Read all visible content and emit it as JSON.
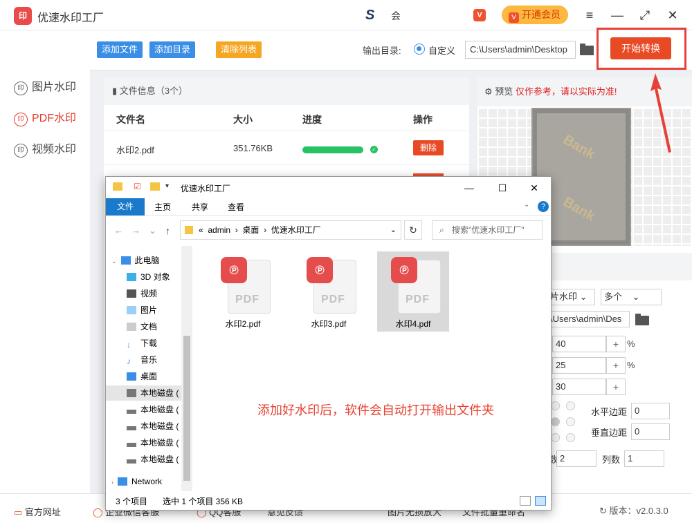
{
  "app": {
    "logo": "印",
    "title": "优速水印工厂",
    "brand_mark": "S",
    "brand_text": "会",
    "vip_icon": "V",
    "vip_button": "开通会员",
    "vip_k": "V"
  },
  "window_controls": {
    "menu": "≡",
    "minimize": "—",
    "maximize": "⤢",
    "close": "✕"
  },
  "sidebar": {
    "items": [
      {
        "icon": "印",
        "label": "图片水印"
      },
      {
        "icon": "印",
        "label": "PDF水印"
      },
      {
        "icon": "印",
        "label": "视频水印"
      }
    ]
  },
  "toolbar": {
    "add_file": "添加文件",
    "add_dir": "添加目录",
    "clear_list": "清除列表",
    "output_label": "输出目录:",
    "radio_custom": "自定义",
    "output_path": "C:\\Users\\admin\\Desktop",
    "start": "开始转换"
  },
  "file_panel": {
    "header": "文件信息（3个）",
    "columns": [
      "文件名",
      "大小",
      "进度",
      "操作"
    ],
    "rows": [
      {
        "name": "水印2.pdf",
        "size": "351.76KB",
        "progress": 1.0,
        "action": "删除"
      }
    ]
  },
  "preview": {
    "title": "预览",
    "warning": "仅作参考，请以实际为准!",
    "watermark_text": "Bank"
  },
  "settings": {
    "type": "片水印",
    "count": "多个",
    "path": "\\Users\\admin\\Des",
    "v1": "40",
    "v2": "25",
    "v3": "30",
    "plus": "+",
    "pct": "%",
    "h_margin_label": "水平边距",
    "h_margin": "0",
    "v_margin_label": "垂直边距",
    "v_margin": "0",
    "rows_label": "数",
    "rows": "2",
    "cols_label": "列数",
    "cols": "1"
  },
  "statusbar": {
    "items": [
      "官方网址",
      "企业微信客服",
      "QQ客服",
      "意见反馈",
      "图片无损放大",
      "文件批量重命名"
    ],
    "version": "版本：v2.0.3.0"
  },
  "explorer": {
    "title": "优速水印工厂",
    "ribbon": [
      "文件",
      "主页",
      "共享",
      "查看"
    ],
    "address": [
      "«",
      "admin",
      "›",
      "桌面",
      "›",
      "优速水印工厂"
    ],
    "search_placeholder": "搜索\"优速水印工厂\"",
    "tree": [
      {
        "label": "此电脑"
      },
      {
        "label": "3D 对象"
      },
      {
        "label": "视频"
      },
      {
        "label": "图片"
      },
      {
        "label": "文档"
      },
      {
        "label": "下载"
      },
      {
        "label": "音乐"
      },
      {
        "label": "桌面"
      },
      {
        "label": "本地磁盘 ("
      },
      {
        "label": "本地磁盘 ("
      },
      {
        "label": "本地磁盘 ("
      },
      {
        "label": "本地磁盘 ("
      },
      {
        "label": "本地磁盘 ("
      },
      {
        "label": "Network"
      }
    ],
    "files": [
      {
        "name": "水印2.pdf",
        "pdf": "PDF"
      },
      {
        "name": "水印3.pdf",
        "pdf": "PDF"
      },
      {
        "name": "水印4.pdf",
        "pdf": "PDF"
      }
    ],
    "note": "添加好水印后，软件会自动打开输出文件夹",
    "status_count": "3 个项目",
    "status_sel": "选中 1 个项目  356 KB"
  },
  "colors": {
    "accent_red": "#e94a26",
    "accent_blue": "#3a8ee6",
    "progress_green": "#27c265"
  }
}
